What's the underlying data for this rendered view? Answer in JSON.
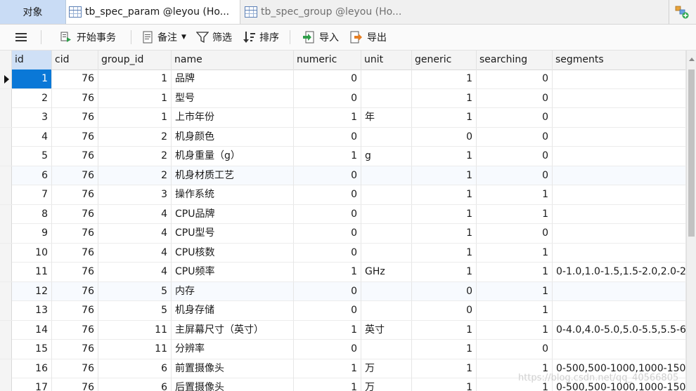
{
  "tabs": [
    {
      "label": "对象"
    },
    {
      "label": "tb_spec_param @leyou (Ho..."
    },
    {
      "label": "tb_spec_group @leyou (Ho..."
    }
  ],
  "toolbar": {
    "begin_transaction": "开始事务",
    "note": "备注",
    "filter": "筛选",
    "sort": "排序",
    "import": "导入",
    "export": "导出"
  },
  "columns": [
    "id",
    "cid",
    "group_id",
    "name",
    "numeric",
    "unit",
    "generic",
    "searching",
    "segments"
  ],
  "rows": [
    [
      "1",
      "76",
      "1",
      "品牌",
      "0",
      "",
      "1",
      "0",
      ""
    ],
    [
      "2",
      "76",
      "1",
      "型号",
      "0",
      "",
      "1",
      "0",
      ""
    ],
    [
      "3",
      "76",
      "1",
      "上市年份",
      "1",
      "年",
      "1",
      "0",
      ""
    ],
    [
      "4",
      "76",
      "2",
      "机身颜色",
      "0",
      "",
      "0",
      "0",
      ""
    ],
    [
      "5",
      "76",
      "2",
      "机身重量（g）",
      "1",
      "g",
      "1",
      "0",
      ""
    ],
    [
      "6",
      "76",
      "2",
      "机身材质工艺",
      "0",
      "",
      "1",
      "0",
      ""
    ],
    [
      "7",
      "76",
      "3",
      "操作系统",
      "0",
      "",
      "1",
      "1",
      ""
    ],
    [
      "8",
      "76",
      "4",
      "CPU品牌",
      "0",
      "",
      "1",
      "1",
      ""
    ],
    [
      "9",
      "76",
      "4",
      "CPU型号",
      "0",
      "",
      "1",
      "0",
      ""
    ],
    [
      "10",
      "76",
      "4",
      "CPU核数",
      "0",
      "",
      "1",
      "1",
      ""
    ],
    [
      "11",
      "76",
      "4",
      "CPU频率",
      "1",
      "GHz",
      "1",
      "1",
      "0-1.0,1.0-1.5,1.5-2.0,2.0-2."
    ],
    [
      "12",
      "76",
      "5",
      "内存",
      "0",
      "",
      "0",
      "1",
      ""
    ],
    [
      "13",
      "76",
      "5",
      "机身存储",
      "0",
      "",
      "0",
      "1",
      ""
    ],
    [
      "14",
      "76",
      "11",
      "主屏幕尺寸（英寸）",
      "1",
      "英寸",
      "1",
      "1",
      "0-4.0,4.0-5.0,5.0-5.5,5.5-6."
    ],
    [
      "15",
      "76",
      "11",
      "分辨率",
      "0",
      "",
      "1",
      "0",
      ""
    ],
    [
      "16",
      "76",
      "6",
      "前置摄像头",
      "1",
      "万",
      "1",
      "1",
      "0-500,500-1000,1000-150"
    ],
    [
      "17",
      "76",
      "6",
      "后置摄像头",
      "1",
      "万",
      "1",
      "1",
      "0-500,500-1000,1000-150"
    ]
  ],
  "watermark": "https://blog.csdn.net/qq_40566805"
}
